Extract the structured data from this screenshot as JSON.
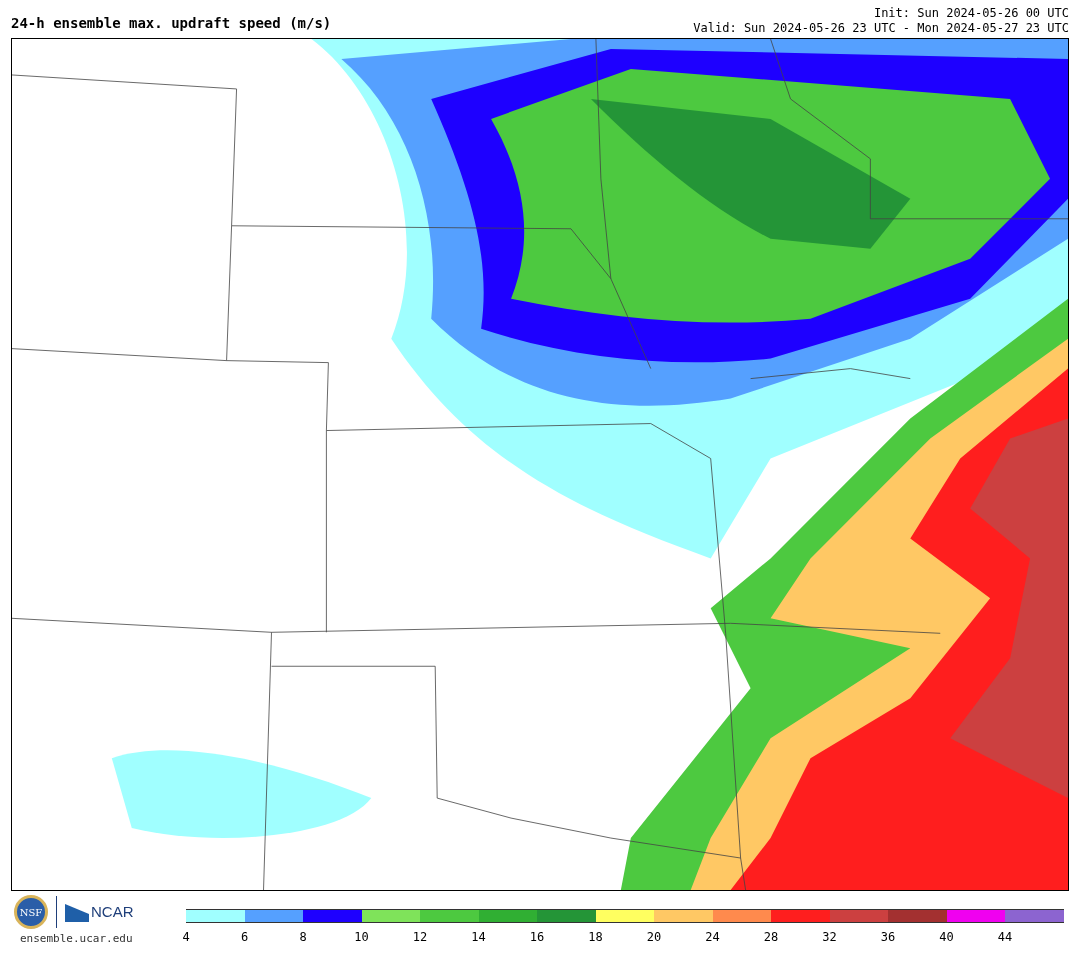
{
  "title": "24-h ensemble max. updraft speed (m/s)",
  "init": "Init: Sun 2024-05-26 00 UTC",
  "valid": "Valid: Sun 2024-05-26 23 UTC - Mon 2024-05-27 23 UTC",
  "logos": {
    "nsf": "NSF",
    "ncar": "NCAR"
  },
  "site": "ensemble.ucar.edu",
  "colorbar": [
    {
      "label": "4",
      "color": "#a0ffff"
    },
    {
      "label": "6",
      "color": "#55a0ff"
    },
    {
      "label": "8",
      "color": "#1e00ff"
    },
    {
      "label": "10",
      "color": "#7fe35a"
    },
    {
      "label": "12",
      "color": "#4dc940"
    },
    {
      "label": "14",
      "color": "#30af33"
    },
    {
      "label": "16",
      "color": "#249537"
    },
    {
      "label": "18",
      "color": "#ffff60"
    },
    {
      "label": "20",
      "color": "#ffc864"
    },
    {
      "label": "24",
      "color": "#ff8a4d"
    },
    {
      "label": "28",
      "color": "#ff1e1e"
    },
    {
      "label": "32",
      "color": "#cc4040"
    },
    {
      "label": "36",
      "color": "#a33030"
    },
    {
      "label": "40",
      "color": "#f000f0"
    },
    {
      "label": "44",
      "color": "#8c64d0"
    }
  ]
}
